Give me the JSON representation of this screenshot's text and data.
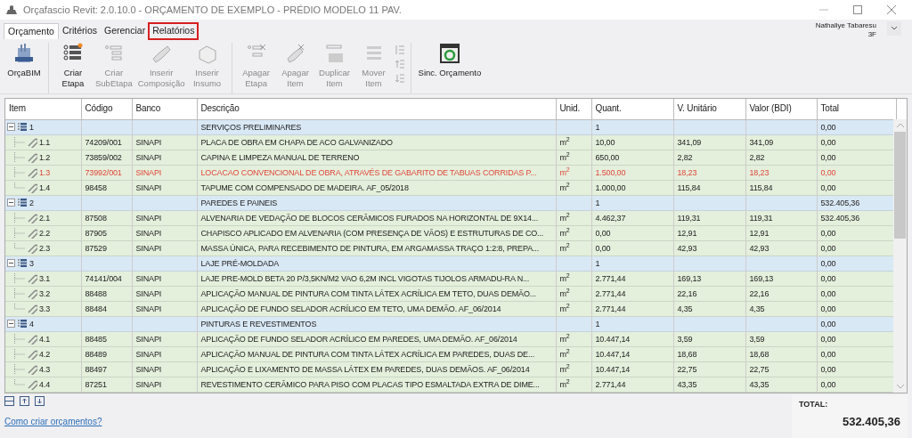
{
  "window": {
    "title": "Orçafascio Revit: 2.0.10.0 - ORÇAMENTO DE EXEMPLO - PRÉDIO MODELO 11 PAV."
  },
  "tabs": [
    {
      "label": "Orçamento",
      "selected": true,
      "highlighted": false
    },
    {
      "label": "Critérios",
      "selected": false,
      "highlighted": false
    },
    {
      "label": "Gerenciar",
      "selected": false,
      "highlighted": false
    },
    {
      "label": "Relatórios",
      "selected": false,
      "highlighted": true
    }
  ],
  "user": {
    "name": "Nathallye Tabaresu",
    "code": "3F"
  },
  "ribbon": [
    [
      {
        "label": "OrçaBIM",
        "disabled": false
      }
    ],
    [
      {
        "label": "Criar Etapa",
        "disabled": false
      },
      {
        "label": "Criar SubEtapa",
        "disabled": true
      },
      {
        "label": "Inserir Composição",
        "disabled": true
      },
      {
        "label": "Inserir Insumo",
        "disabled": true
      }
    ],
    [
      {
        "label": "Apagar Etapa",
        "disabled": true
      },
      {
        "label": "Apagar Item",
        "disabled": true
      },
      {
        "label": "Duplicar Item",
        "disabled": true
      },
      {
        "label": "Mover Item",
        "disabled": true
      }
    ],
    [
      {
        "label": "Sinc. Orçamento",
        "disabled": false
      }
    ]
  ],
  "table": {
    "columns": [
      "Item",
      "Código",
      "Banco",
      "Descrição",
      "Unid.",
      "Quant.",
      "V. Unitário",
      "Valor (BDI)",
      "Total"
    ],
    "rows": [
      {
        "item": "1",
        "description": "SERVIÇOS PRELIMINARES",
        "quantity": "1",
        "total": "0,00",
        "expanded": true,
        "children": [
          {
            "item": "1.1",
            "code": "74209/001",
            "bank": "SINAPI",
            "description": "PLACA DE OBRA EM CHAPA DE ACO GALVANIZADO",
            "unit": "m$^{2}$",
            "quantity": "10,00",
            "unit_price": "341,09",
            "value_bdi": "341,09",
            "total": "0,00",
            "warning": false
          },
          {
            "item": "1.2",
            "code": "73859/002",
            "bank": "SINAPI",
            "description": "CAPINA E LIMPEZA MANUAL DE TERRENO",
            "unit": "m$^{2}$",
            "quantity": "650,00",
            "unit_price": "2,82",
            "value_bdi": "2,82",
            "total": "0,00",
            "warning": false
          },
          {
            "item": "1.3",
            "code": "73992/001",
            "bank": "SINAPI",
            "description": "LOCACAO CONVENCIONAL DE OBRA, ATRAVÉS DE GABARITO DE TABUAS CORRIDAS P...",
            "unit": "m$^{2}$",
            "quantity": "1.500,00",
            "unit_price": "18,23",
            "value_bdi": "18,23",
            "total": "0,00",
            "warning": true
          },
          {
            "item": "1.4",
            "code": "98458",
            "bank": "SINAPI",
            "description": "TAPUME COM COMPENSADO DE MADEIRA. AF_05/2018",
            "unit": "m$^{2}$",
            "quantity": "1.000,00",
            "unit_price": "115,84",
            "value_bdi": "115,84",
            "total": "0,00",
            "warning": false
          }
        ]
      },
      {
        "item": "2",
        "description": "PAREDES E PAINEIS",
        "quantity": "1",
        "total": "532.405,36",
        "expanded": true,
        "children": [
          {
            "item": "2.1",
            "code": "87508",
            "bank": "SINAPI",
            "description": "ALVENARIA DE VEDAÇÃO DE BLOCOS CERÂMICOS FURADOS NA HORIZONTAL DE 9X14...",
            "unit": "m$^{2}$",
            "quantity": "4.462,37",
            "unit_price": "119,31",
            "value_bdi": "119,31",
            "total": "532.405,36",
            "warning": false
          },
          {
            "item": "2.2",
            "code": "87905",
            "bank": "SINAPI",
            "description": "CHAPISCO APLICADO EM ALVENARIA (COM PRESENÇA DE VÃOS) E ESTRUTURAS DE CO...",
            "unit": "m$^{2}$",
            "quantity": "0,00",
            "unit_price": "12,91",
            "value_bdi": "12,91",
            "total": "0,00",
            "warning": false
          },
          {
            "item": "2.3",
            "code": "87529",
            "bank": "SINAPI",
            "description": "MASSA ÚNICA, PARA RECEBIMENTO DE PINTURA, EM ARGAMASSA TRAÇO 1:2:8, PREPA...",
            "unit": "m$^{2}$",
            "quantity": "0,00",
            "unit_price": "42,93",
            "value_bdi": "42,93",
            "total": "0,00",
            "warning": false
          }
        ]
      },
      {
        "item": "3",
        "description": "LAJE PRÉ-MOLDADA",
        "quantity": "1",
        "total": "0,00",
        "expanded": true,
        "children": [
          {
            "item": "3.1",
            "code": "74141/004",
            "bank": "SINAPI",
            "description": "LAJE PRE-MOLD BETA 20 P/3,5KN/M2 VAO 6,2M INCL VIGOTAS TIJOLOS ARMADU-RA N...",
            "unit": "m$^{2}$",
            "quantity": "2.771,44",
            "unit_price": "169,13",
            "value_bdi": "169,13",
            "total": "0,00",
            "warning": false
          },
          {
            "item": "3.2",
            "code": "88488",
            "bank": "SINAPI",
            "description": "APLICAÇÃO MANUAL DE PINTURA COM TINTA LÁTEX ACRÍLICA EM TETO, DUAS DEMÃO...",
            "unit": "m$^{2}$",
            "quantity": "2.771,44",
            "unit_price": "22,16",
            "value_bdi": "22,16",
            "total": "0,00",
            "warning": false
          },
          {
            "item": "3.3",
            "code": "88484",
            "bank": "SINAPI",
            "description": "APLICAÇÃO DE FUNDO SELADOR ACRÍLICO EM TETO, UMA DEMÃO. AF_06/2014",
            "unit": "m$^{2}$",
            "quantity": "2.771,44",
            "unit_price": "4,35",
            "value_bdi": "4,35",
            "total": "0,00",
            "warning": false
          }
        ]
      },
      {
        "item": "4",
        "description": "PINTURAS E REVESTIMENTOS",
        "quantity": "1",
        "total": "0,00",
        "expanded": true,
        "children": [
          {
            "item": "4.1",
            "code": "88485",
            "bank": "SINAPI",
            "description": "APLICAÇÃO DE FUNDO SELADOR ACRÍLICO EM PAREDES, UMA DEMÃO. AF_06/2014",
            "unit": "m$^{2}$",
            "quantity": "10.447,14",
            "unit_price": "3,59",
            "value_bdi": "3,59",
            "total": "0,00",
            "warning": false
          },
          {
            "item": "4.2",
            "code": "88489",
            "bank": "SINAPI",
            "description": "APLICAÇÃO MANUAL DE PINTURA COM TINTA LÁTEX ACRÍLICA EM PAREDES, DUAS DE...",
            "unit": "m$^{2}$",
            "quantity": "10.447,14",
            "unit_price": "18,68",
            "value_bdi": "18,68",
            "total": "0,00",
            "warning": false
          },
          {
            "item": "4.3",
            "code": "88497",
            "bank": "SINAPI",
            "description": "APLICAÇÃO E LIXAMENTO DE MASSA LÁTEX EM PAREDES, DUAS DEMÃOS. AF_06/2014",
            "unit": "m$^{2}$",
            "quantity": "10.447,14",
            "unit_price": "22,75",
            "value_bdi": "22,75",
            "total": "0,00",
            "warning": false
          },
          {
            "item": "4.4",
            "code": "87251",
            "bank": "SINAPI",
            "description": "REVESTIMENTO CERÂMICO PARA PISO COM PLACAS TIPO ESMALTADA EXTRA DE DIME...",
            "unit": "m$^{2}$",
            "quantity": "2.771,44",
            "unit_price": "43,35",
            "value_bdi": "43,35",
            "total": "0,00",
            "warning": false
          }
        ]
      }
    ]
  },
  "help_link": "Como criar orçamentos?",
  "grand_total": {
    "label": "TOTAL:",
    "value": "532.405,36"
  }
}
